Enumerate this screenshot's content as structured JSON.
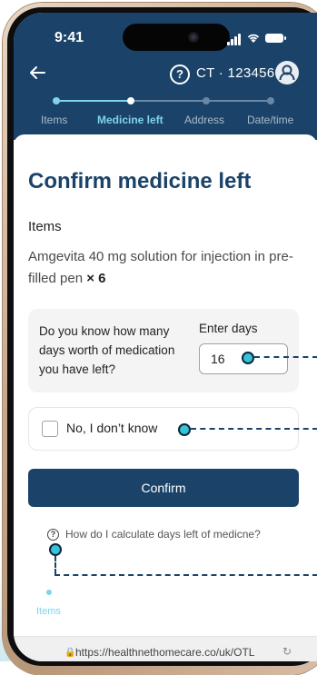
{
  "status_bar": {
    "time": "9:41"
  },
  "header": {
    "case_id": "CT · 123456",
    "steps": [
      {
        "label": "Items",
        "state": "done"
      },
      {
        "label": "Medicine left",
        "state": "active"
      },
      {
        "label": "Address",
        "state": "pending"
      },
      {
        "label": "Date/time",
        "state": "pending"
      }
    ]
  },
  "main": {
    "title": "Confirm medicine left",
    "items_heading": "Items",
    "item_name": "Amgevita 40 mg solution for injection in pre-filled pen",
    "item_qty": "× 6",
    "question": "Do you know how many days worth of medication you have left?",
    "days_label": "Enter days",
    "days_value": "16",
    "dont_know_label": "No, I don’t know",
    "confirm_label": "Confirm",
    "help_link": "How do I calculate days left of medicne?"
  },
  "footer": {
    "bottom_label": "Items",
    "url": "https://healthnethomecare.co/uk/OTL"
  },
  "colors": {
    "brand": "#1b4369",
    "accent": "#7fd3ec",
    "marker": "#37c3d3"
  }
}
